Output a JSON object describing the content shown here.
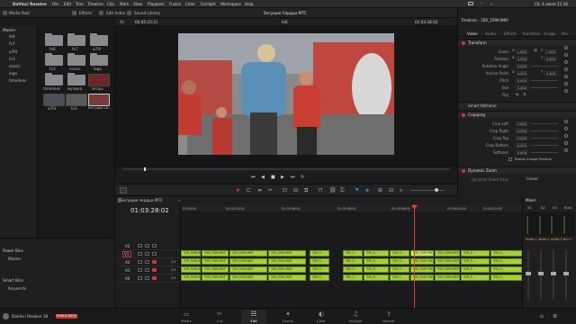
{
  "menubar": {
    "apple": "",
    "items": [
      "DaVinci Resolve",
      "File",
      "Edit",
      "Trim",
      "Timeline",
      "Clip",
      "Mark",
      "View",
      "Playback",
      "Fusion",
      "Color",
      "Fairlight",
      "Workspace",
      "Help"
    ],
    "right_status": "Сб, 4 июня 11:26"
  },
  "toolbar": {
    "left": [
      "Media Pool",
      "Effects",
      "Edit Index",
      "Sound Library"
    ],
    "center_title": "Бегущие Сердца МТС",
    "right": [
      "Mixer",
      "Metadata",
      "Inspector"
    ]
  },
  "viewer": {
    "zoom": "Fit",
    "timecode_left": "00:45:23:21",
    "title": "fx6",
    "timecode_right": "01:03:28:02"
  },
  "bins": {
    "master": "Master",
    "items": [
      "fx6",
      "fx7",
      "a7III",
      "fx3",
      "mavic",
      "logo",
      "timelines"
    ]
  },
  "pool": {
    "clips": [
      {
        "label": "fx6",
        "type": "folder"
      },
      {
        "label": "fx7",
        "type": "folder"
      },
      {
        "label": "a7III",
        "type": "folder"
      },
      {
        "label": "fx3",
        "type": "folder"
      },
      {
        "label": "mavic",
        "type": "folder"
      },
      {
        "label": "logo",
        "type": "folder"
      },
      {
        "label": "timelines",
        "type": "folder"
      },
      {
        "label": "музыка",
        "type": "folder"
      },
      {
        "label": "титры",
        "type": "folder"
      },
      {
        "label": "a7III",
        "type": "clip"
      },
      {
        "label": "fx3",
        "type": "clip"
      },
      {
        "label": "Бегущие се...",
        "type": "clip"
      }
    ]
  },
  "inspector": {
    "title": "Timeline - 359_5599.MXF",
    "tabs": [
      "Video",
      "Audio",
      "Effects",
      "Transition",
      "Image",
      "File"
    ],
    "transform_label": "Transform",
    "rows": [
      {
        "label": "Zoom",
        "x": "1.000",
        "y": "1.000"
      },
      {
        "label": "Position",
        "x": "0.000",
        "y": "0.000"
      },
      {
        "label": "Rotation Angle",
        "x": "0.000",
        "y": ""
      },
      {
        "label": "Anchor Point",
        "x": "0.000",
        "y": "0.000"
      },
      {
        "label": "Pitch",
        "x": "0.000",
        "y": ""
      },
      {
        "label": "Yaw",
        "x": "0.000",
        "y": ""
      },
      {
        "label": "Flip",
        "x": "",
        "y": ""
      }
    ],
    "smart_reframe": "Smart Reframe",
    "cropping_label": "Cropping",
    "crop_rows": [
      {
        "label": "Crop Left",
        "value": "0.000"
      },
      {
        "label": "Crop Right",
        "value": "0.000"
      },
      {
        "label": "Crop Top",
        "value": "0.000"
      },
      {
        "label": "Crop Bottom",
        "value": "0.000"
      },
      {
        "label": "Softness",
        "value": "0.000"
      }
    ],
    "retain_label": "Retain Image Position",
    "dynamic_zoom": "Dynamic Zoom",
    "dz_row": {
      "label": "Dynamic Zoom Ease",
      "value": "Linear"
    }
  },
  "timeline": {
    "tab": "Бегущие сердца МТС",
    "timecode": "01:03:28:02",
    "ruler": [
      "01:00:00",
      "01:02:12:00",
      "01:03:36:00",
      "01:03:48:00",
      "01:03:56:00",
      "01:04:12:00",
      "01:04:22:00",
      "01:04:30:00"
    ],
    "tracks": [
      {
        "id": "V2",
        "label": "V2"
      },
      {
        "id": "V1",
        "label": "V1"
      },
      {
        "id": "A2",
        "label": "A2"
      },
      {
        "id": "A3",
        "label": "A3"
      },
      {
        "id": "A4",
        "label": "A4"
      }
    ],
    "clip_names": [
      "359_5589.MXF",
      "359_5590.MXF",
      "359_5593.MXF",
      "359_5594.MXF",
      "359_5591.MXF",
      "359_5...",
      "359_5...",
      "359_5...",
      "359_5...",
      "359_5597.MXF",
      "359_5593.MXF",
      "359_5...",
      "359_5..."
    ]
  },
  "mixer": {
    "title": "Mixer",
    "channels": [
      "A1",
      "A2",
      "A3",
      "Bus1"
    ],
    "audio_labels": [
      "Audio 1",
      "Audio 2",
      "Audio 3",
      "Bus 1"
    ]
  },
  "power_bins": {
    "title": "Power Bins",
    "master": "Master",
    "smart": "Smart Bins",
    "keywords": "Keywords"
  },
  "app": {
    "name": "DaVinci Resolve 18",
    "badge": "PUBLIC BETA"
  },
  "pages": [
    "Media",
    "Cut",
    "Edit",
    "Fusion",
    "Color",
    "Fairlight",
    "Deliver"
  ],
  "active_page": "Edit"
}
